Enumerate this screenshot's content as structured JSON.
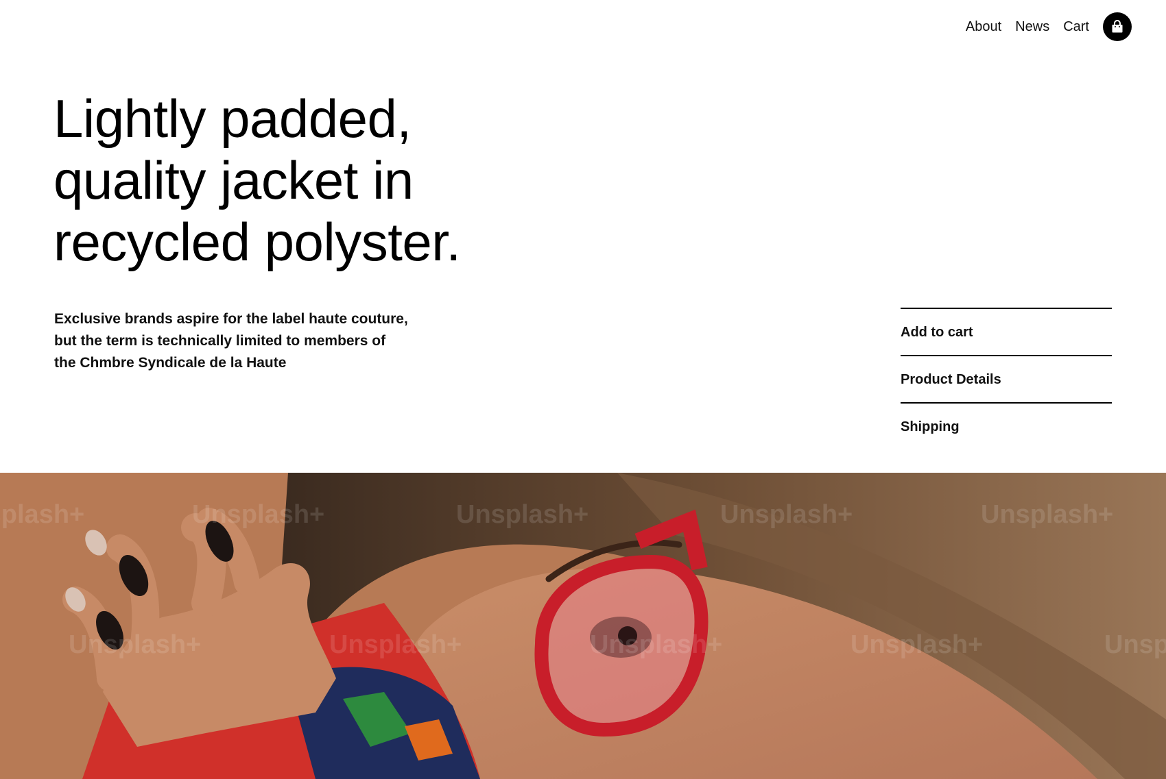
{
  "nav": {
    "links": [
      "About",
      "News",
      "Cart"
    ],
    "bag_icon": "shopping-bag-icon"
  },
  "hero": {
    "title_lines": [
      "Lightly padded,",
      "quality jacket in",
      "recycled polyster."
    ],
    "description": "Exclusive brands aspire for the label haute couture, but the term is technically limited to members of the Chmbre Syndicale de la Haute"
  },
  "accordion": {
    "items": [
      "Add to cart",
      "Product Details",
      "Shipping"
    ]
  },
  "photo": {
    "watermark": "Unsplash+",
    "colors": {
      "background": "#b77a55",
      "hair": "#6b4a33",
      "glasses": "#c81e2a",
      "sweater": "#d0302a",
      "nails": "#1c1412"
    }
  }
}
